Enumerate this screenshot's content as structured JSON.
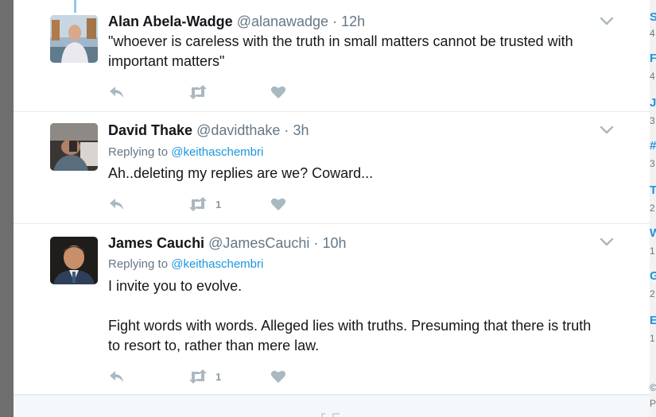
{
  "tweets": [
    {
      "fullname": "Alan Abela-Wadge",
      "username": "@alanawadge",
      "separator": "·",
      "time": "12h",
      "replying_label": "",
      "replying_to": "",
      "text": [
        "\"whoever is careless with the truth in small matters cannot be trusted with important matters\""
      ],
      "retweet_count": ""
    },
    {
      "fullname": "David Thake",
      "username": "@davidthake",
      "separator": "·",
      "time": "3h",
      "replying_label": "Replying to",
      "replying_to": "@keithaschembri",
      "text": [
        "Ah..deleting my replies are we? Coward..."
      ],
      "retweet_count": "1"
    },
    {
      "fullname": "James Cauchi",
      "username": "@JamesCauchi",
      "separator": "·",
      "time": "10h",
      "replying_label": "Replying to",
      "replying_to": "@keithaschembri",
      "text": [
        "I invite you to evolve.",
        "Fight words with words. Alleged lies with truths. Presuming that there is truth to resort to, rather than mere law."
      ],
      "retweet_count": "1"
    }
  ],
  "icons": {
    "reply": "reply-icon",
    "retweet": "retweet-icon",
    "like": "heart-icon",
    "caret": "chevron-down-icon"
  },
  "colors": {
    "text": "#14171a",
    "secondary": "#657786",
    "link": "#1b95e0",
    "action": "#aab8c2",
    "thread_line": "#8ecbe8"
  },
  "right_strip": {
    "items": [
      {
        "title": "S",
        "sub": "4"
      },
      {
        "title": "F",
        "sub": "4"
      },
      {
        "title": "J",
        "sub": "3"
      },
      {
        "title": "#",
        "sub": "3"
      },
      {
        "title": "T",
        "sub": "2"
      },
      {
        "title": "W",
        "sub": "1"
      },
      {
        "title": "G",
        "sub": "2"
      },
      {
        "title": "E",
        "sub": "1"
      }
    ],
    "footer": [
      "©",
      "P"
    ]
  }
}
